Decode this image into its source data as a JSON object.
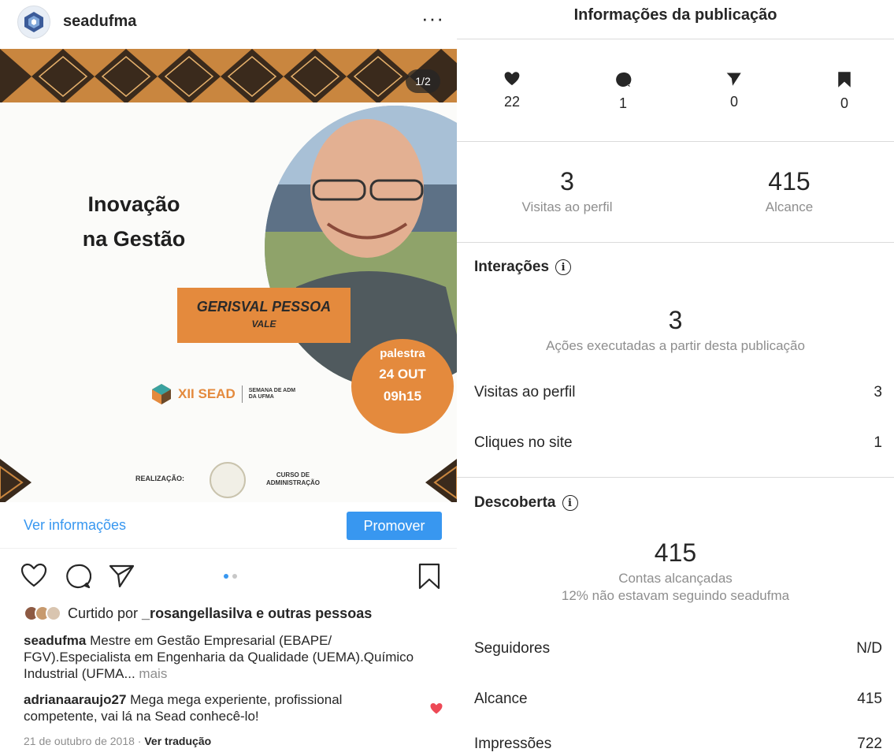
{
  "post": {
    "username": "seadufma",
    "more_icon": "more-options-icon",
    "slide_counter": "1/2",
    "image": {
      "title_line1": "Inovação",
      "title_line2": "na Gestão",
      "speaker_name": "GERISVAL PESSOA",
      "speaker_surname": "VALE",
      "event_type": "palestra",
      "event_date": "24 OUT",
      "event_time": "09h15",
      "event_logo_text": "XII SEAD",
      "event_logo_sub": "SEMANA DE ADM DA UFMA",
      "realizacao": "REALIZAÇÃO:",
      "curso": "CURSO DE ADMINISTRAÇÃO"
    },
    "ver_info": "Ver informações",
    "promote": "Promover",
    "liked_prefix": "Curtido por ",
    "liked_user": "_rosangellasilva",
    "liked_suffix": " e outras pessoas",
    "caption_user": "seadufma",
    "caption_text": " Mestre em Gestão Empresarial (EBAPE/ FGV).Especialista em Engenharia da Qualidade (UEMA).Químico Industrial (UFMA...",
    "caption_more": " mais",
    "comment_user": "adrianaaraujo27",
    "comment_text": " Mega mega experiente, profissional competente, vai lá na Sead conhecê-lo!",
    "date": "21 de outubro de 2018 · ",
    "translate": "Ver tradução"
  },
  "insights": {
    "title": "Informações da publicação",
    "likes": "22",
    "comments": "1",
    "shares": "0",
    "saves": "0",
    "profile_visits": "3",
    "profile_visits_label": "Visitas ao perfil",
    "reach": "415",
    "reach_label": "Alcance",
    "interactions": {
      "heading": "Interações",
      "total": "3",
      "total_label": "Ações executadas a partir desta publicação",
      "rows": [
        {
          "label": "Visitas ao perfil",
          "value": "3"
        },
        {
          "label": "Cliques no site",
          "value": "1"
        }
      ]
    },
    "discovery": {
      "heading": "Descoberta",
      "total": "415",
      "total_label": "Contas alcançadas",
      "sub_label": "12% não estavam seguindo seadufma",
      "rows": [
        {
          "label": "Seguidores",
          "value": "N/D"
        },
        {
          "label": "Alcance",
          "value": "415"
        },
        {
          "label": "Impressões",
          "value": "722"
        }
      ]
    }
  },
  "colors": {
    "accent": "#3897f0",
    "orange": "#e48a3d",
    "like_red": "#ed4956"
  }
}
